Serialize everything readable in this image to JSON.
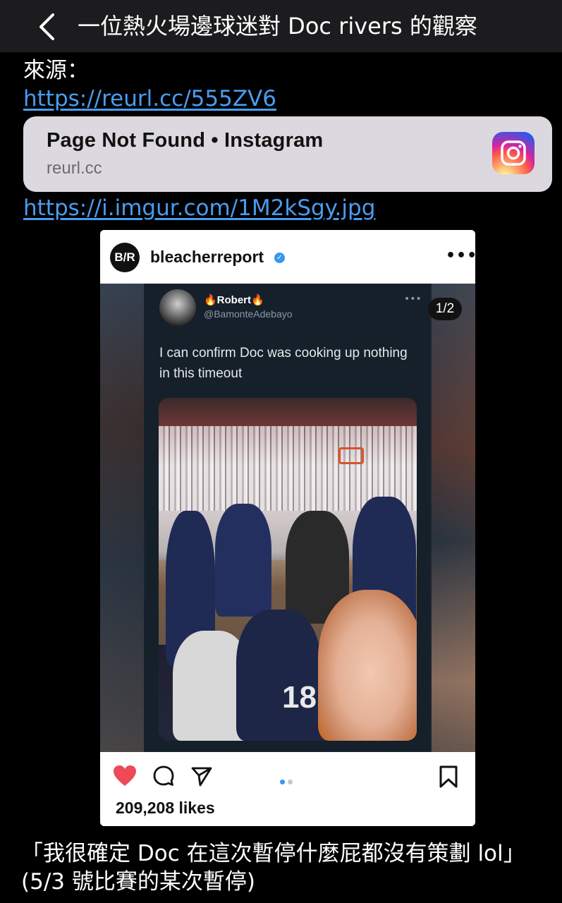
{
  "header": {
    "title": "一位熱火場邊球迷對 Doc rivers 的觀察",
    "back_icon": "chevron-left-icon"
  },
  "body": {
    "source_label": "來源：",
    "link1": "https://reurl.cc/555ZV6",
    "preview": {
      "title": "Page Not Found • Instagram",
      "domain": "reurl.cc",
      "icon": "instagram-icon"
    },
    "link2": "https://i.imgur.com/1M2kSgy.jpg",
    "caption_line1": "「我很確定 Doc 在這次暫停什麼屁都沒有策劃 lol」",
    "caption_line2": "(5/3 號比賽的某次暫停)"
  },
  "post": {
    "avatar_text": "B/R",
    "username": "bleacherreport",
    "counter": "1/2",
    "likes": "209,208 likes",
    "tweet": {
      "name": "🔥Robert🔥",
      "handle": "@BamonteAdebayo",
      "text": "I can confirm Doc was cooking up nothing in this timeout",
      "jersey_number": "18"
    }
  },
  "colors": {
    "link": "#4a9cf0",
    "preview_bg": "#dcd8df",
    "heart": "#ed4956",
    "tweet_bg": "#15202b"
  }
}
